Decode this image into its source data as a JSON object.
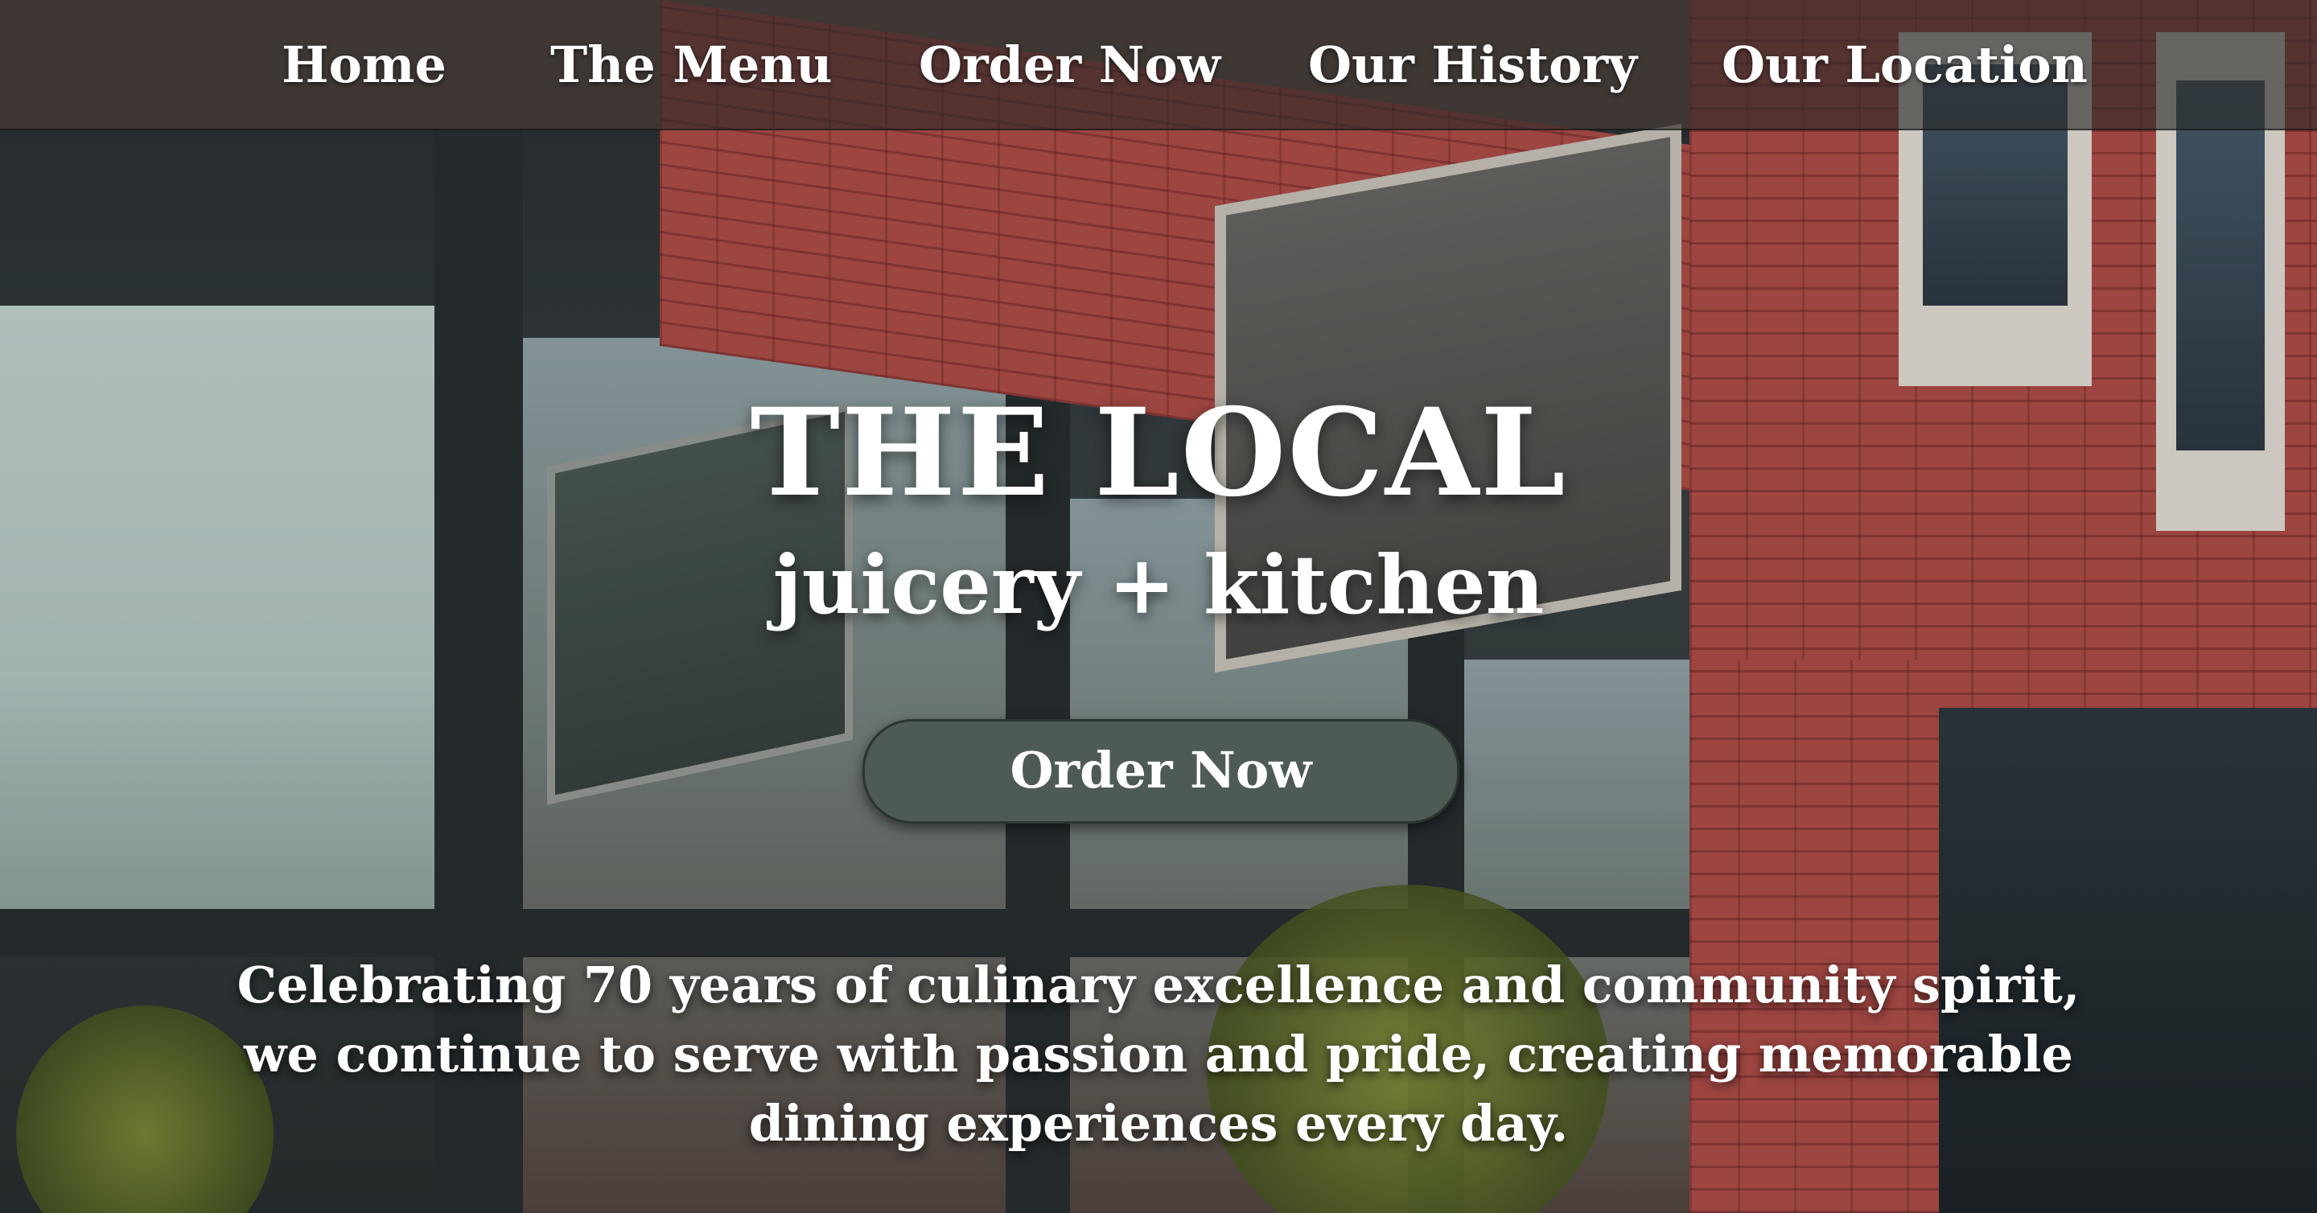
{
  "nav": {
    "items": [
      {
        "label": "Home"
      },
      {
        "label": "The Menu"
      },
      {
        "label": "Order Now"
      },
      {
        "label": "Our History"
      },
      {
        "label": "Our Location"
      }
    ]
  },
  "hero": {
    "title": "THE LOCAL",
    "subtitle": "juicery + kitchen",
    "cta_label": "Order Now",
    "tagline": "Celebrating 70 years of culinary excellence and community spirit, we continue to serve with passion and pride, creating memorable dining experiences every day."
  },
  "colors": {
    "nav_background": "#282828",
    "cta_background": "#4e5b55",
    "text": "#ffffff"
  }
}
